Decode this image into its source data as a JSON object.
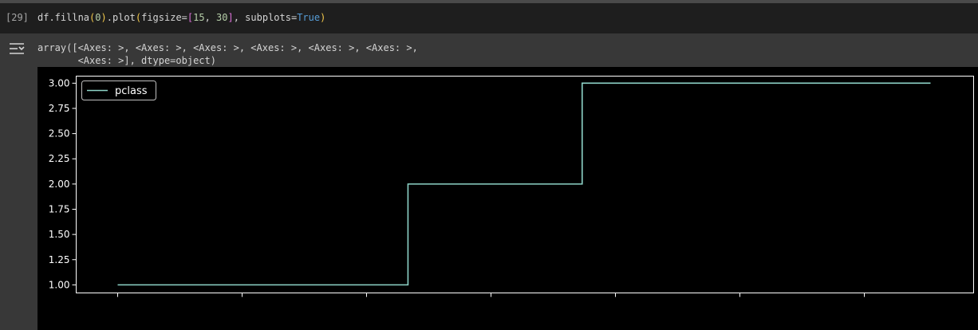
{
  "cell": {
    "execution_count": "[29]",
    "code": {
      "t1": "df.fillna",
      "t2": "(",
      "t3": "0",
      "t4": ")",
      "t5": ".plot",
      "t6": "(",
      "t7": "figsize=",
      "t8": "[",
      "t9": "15",
      "t10": ", ",
      "t11": "30",
      "t12": "]",
      "t13": ", subplots=",
      "t14": "True",
      "t15": ")"
    }
  },
  "output": {
    "icon": "output-toggle-icon",
    "line1": "array([<Axes: >, <Axes: >, <Axes: >, <Axes: >, <Axes: >, <Axes: >,",
    "line2": "       <Axes: >], dtype=object)"
  },
  "chart_data": {
    "type": "line",
    "drawstyle": "steps",
    "x": [
      0,
      1,
      2,
      3,
      4,
      5,
      6,
      7,
      8,
      9,
      10,
      11,
      12,
      13,
      14
    ],
    "series": [
      {
        "name": "pclass",
        "values": [
          1,
          1,
          1,
          1,
          1,
          2,
          2,
          2,
          3,
          3,
          3,
          3,
          3,
          3,
          3
        ],
        "color": "#8dd3c7"
      }
    ],
    "ylim": [
      0.92,
      3.07
    ],
    "yticks": [
      1.0,
      1.25,
      1.5,
      1.75,
      2.0,
      2.25,
      2.5,
      2.75,
      3.0
    ],
    "ytick_labels": [
      "1.00",
      "1.25",
      "1.50",
      "1.75",
      "2.00",
      "2.25",
      "2.50",
      "2.75",
      "3.00"
    ],
    "xticks_count": 7,
    "xtick_labels_visible": false,
    "legend": "top-left",
    "grid": false,
    "background": "#000000",
    "axis_color": "#ffffff"
  }
}
